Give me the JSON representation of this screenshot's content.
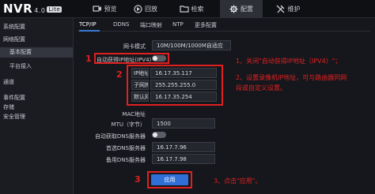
{
  "header": {
    "logo": "NVR",
    "version": "4.0",
    "badge": "Lite",
    "nav": [
      {
        "label": "预览",
        "icon": "camera-icon"
      },
      {
        "label": "回放",
        "icon": "playback-icon"
      },
      {
        "label": "检索",
        "icon": "folder-icon"
      },
      {
        "label": "配置",
        "icon": "gear-icon"
      },
      {
        "label": "维护",
        "icon": "tools-icon"
      }
    ]
  },
  "sidebar": {
    "items": [
      {
        "label": "系统配置"
      },
      {
        "label": "网络配置"
      },
      {
        "label": "基本配置"
      },
      {
        "label": "平台接入"
      },
      {
        "label": "通道"
      },
      {
        "label": "事件配置"
      },
      {
        "label": "存储"
      },
      {
        "label": "安全管理"
      }
    ]
  },
  "tabs": [
    "TCP/IP",
    "DDNS",
    "端口映射",
    "NTP",
    "更多配置"
  ],
  "form": {
    "nic_label": "网卡模式",
    "nic_value": "10M/100M/1000M自适应",
    "dhcp_label": "自动获得IP地址(IPV4)",
    "ip_label": "IP地址",
    "ip_value": "16.17.35.117",
    "mask_label": "子网掩码",
    "mask_value": "255.255.255.0",
    "gw_label": "默认网关",
    "gw_value": "16.17.35.254",
    "mac_label": "MAC地址",
    "mtu_label": "MTU（字节）",
    "mtu_value": "1500",
    "autodns_label": "自动获取DNS服务器",
    "dns1_label": "首选DNS服务器",
    "dns1_value": "16.17.7.96",
    "dns2_label": "备用DNS服务器",
    "dns2_value": "16.17.7.98",
    "apply_label": "应用"
  },
  "annotations": {
    "n1": "1",
    "n2": "2",
    "n3": "3",
    "note1_line1": "1、关闭\"自动获得IP地址（IPV4）\"；",
    "note2_line1": "2、设置录像机IP地址，可与路由器同网",
    "note2_line2": "段或自定义设置。",
    "note3": "3、点击\"应用\"。"
  },
  "colors": {
    "annotation": "#e02020",
    "accent": "#2f6fd6",
    "background": "#16171c"
  }
}
